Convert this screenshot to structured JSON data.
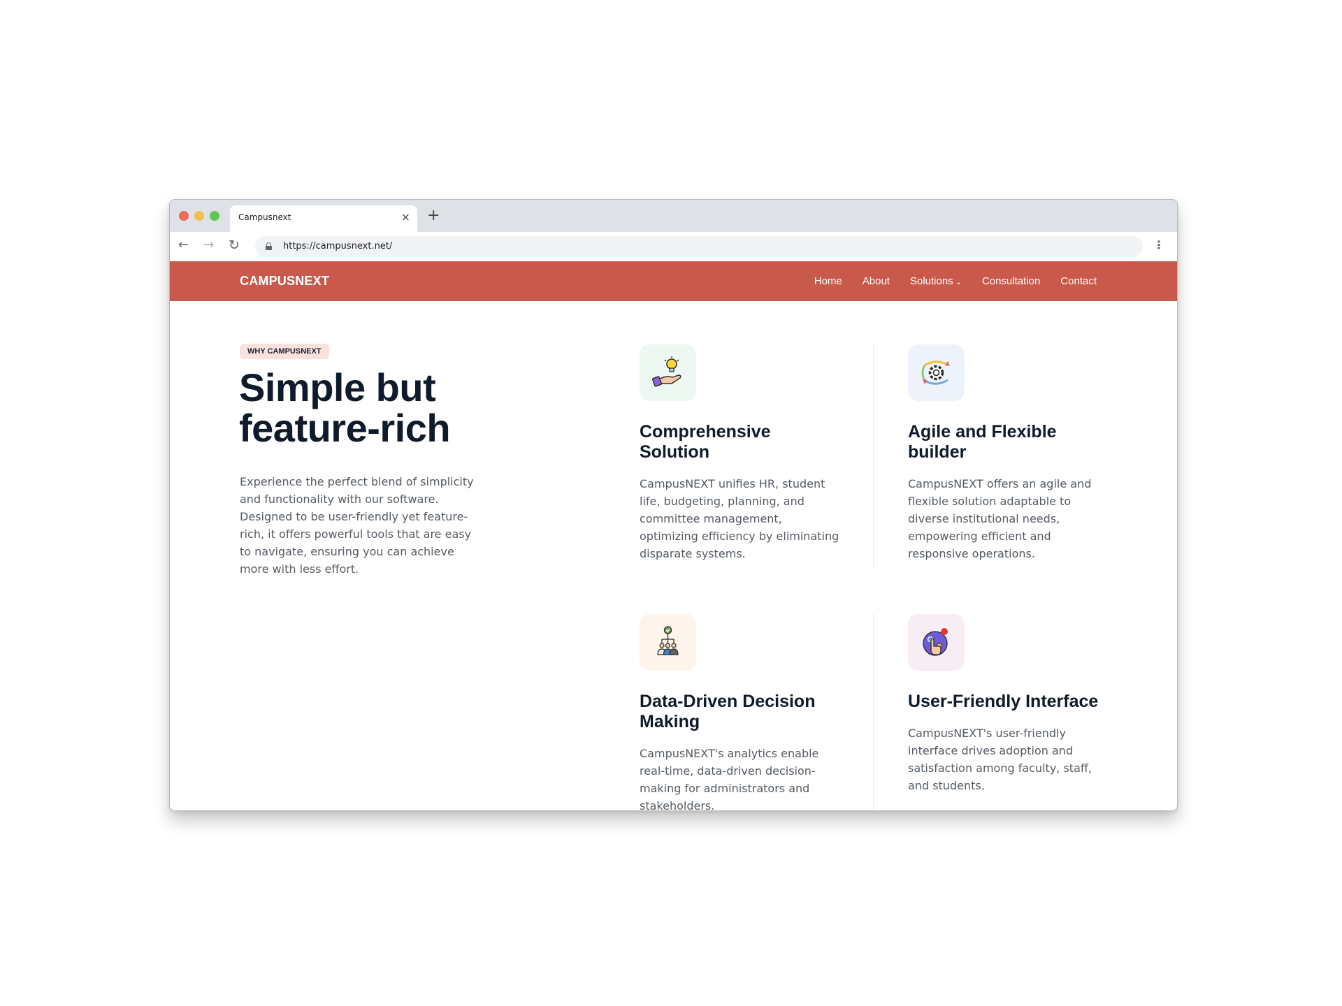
{
  "browser": {
    "tab_title": "Campusnext",
    "tab_close": "×",
    "new_tab": "+",
    "url": "https://campusnext.net/",
    "back": "←",
    "forward": "→",
    "reload": "↻",
    "menu": "⋮"
  },
  "site": {
    "logo": "CAMPUSNEXT",
    "nav": [
      "Home",
      "About",
      "Solutions",
      "Consultation",
      "Contact"
    ],
    "brand_color": "#c95a4b"
  },
  "hero": {
    "badge": "WHY CAMPUSNEXT",
    "title": "Simple but feature-rich",
    "body": "Experience the perfect blend of simplicity and functionality with our software. Designed to be user-friendly yet feature-rich, it offers powerful tools that are easy to navigate, ensuring you can achieve more with less effort."
  },
  "features": [
    {
      "icon": "lightbulb-hand-icon",
      "title": "Comprehensive Solution",
      "body": "CampusNEXT unifies HR, student life, budgeting, planning, and committee management, optimizing efficiency by eliminating disparate systems."
    },
    {
      "icon": "gear-arrows-icon",
      "title": "Agile and Flexible builder",
      "body": "CampusNEXT offers an agile and flexible solution adaptable to diverse institutional needs, empowering efficient and responsive operations."
    },
    {
      "icon": "team-decision-icon",
      "title": "Data-Driven Decision Making",
      "body": "CampusNEXT's analytics enable real-time, data-driven decision-making for administrators and stakeholders."
    },
    {
      "icon": "touch-hand-icon",
      "title": "User-Friendly Interface",
      "body": "CampusNEXT's user-friendly interface drives adoption and satisfaction among faculty, staff, and students."
    }
  ],
  "scroll_top_icon": "arrow-up-icon"
}
